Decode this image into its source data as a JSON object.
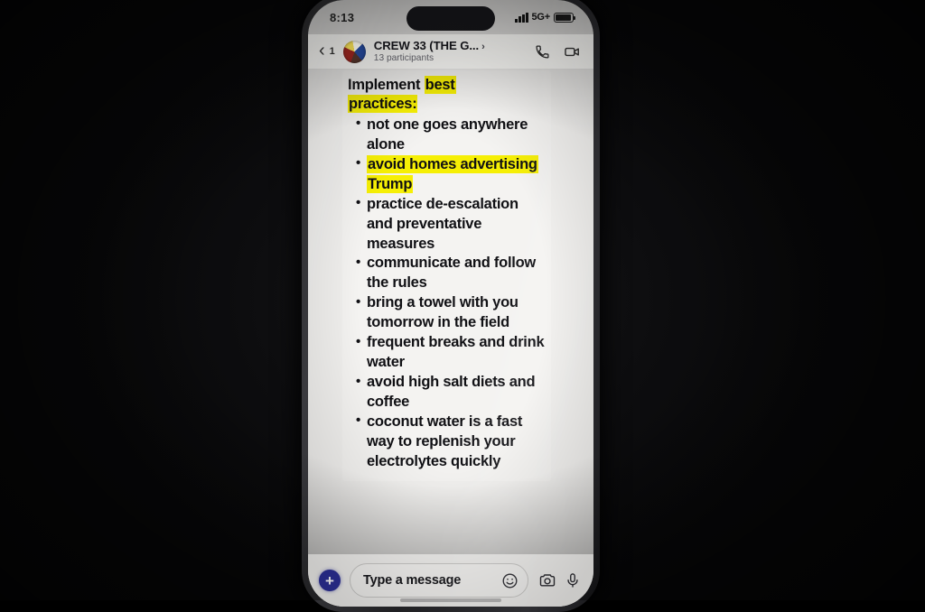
{
  "scene": {
    "background_color": "#08080a",
    "device": "smartphone photographed in a dark room"
  },
  "status_bar": {
    "clock": "8:13",
    "network": "5G+",
    "signal_icon": "signal-bars-icon",
    "battery_icon": "battery-icon",
    "dynamic_island": "dynamic-island"
  },
  "chat_header": {
    "back_icon": "chevron-left-icon",
    "unread_count": "1",
    "avatar": "group-avatar",
    "title": "CREW 33 (THE G...",
    "title_chevron": "›",
    "participants": "13 participants",
    "call_icon": "phone-icon",
    "video_icon": "video-camera-icon"
  },
  "message": {
    "title_plain": "Implement ",
    "title_highlight_1": "best",
    "title_highlight_2": "practices:",
    "bullets": [
      {
        "text": "not one goes anywhere alone",
        "highlighted": false
      },
      {
        "text": "avoid homes advertising Trump",
        "highlighted": true
      },
      {
        "text": "practice de-escalation and preventative measures",
        "highlighted": false
      },
      {
        "text": "communicate and follow the rules",
        "highlighted": false
      },
      {
        "text": "bring a towel with you tomorrow in the field",
        "highlighted": false
      },
      {
        "text": "frequent breaks and drink water",
        "highlighted": false
      },
      {
        "text": "avoid high salt diets and coffee",
        "highlighted": false
      },
      {
        "text": "coconut water is a fast way to replenish your electrolytes quickly",
        "highlighted": false
      }
    ],
    "highlight_color": "#f6ef05",
    "bubble_color": "#f4f3f1"
  },
  "composer": {
    "plus_label": "+",
    "plus_color": "#2b2f96",
    "placeholder": "Type a message",
    "emoji_icon": "smiley-face-icon",
    "camera_icon": "camera-icon",
    "mic_icon": "microphone-icon"
  }
}
